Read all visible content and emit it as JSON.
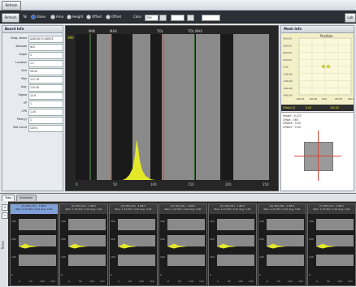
{
  "titlebar": {
    "button_label": "Refresh"
  },
  "toolbar": {
    "view_label": "Tol",
    "radios": [
      {
        "label": "Value",
        "on": true
      },
      {
        "label": "Area",
        "on": false
      },
      {
        "label": "Height",
        "on": false
      },
      {
        "label": "Offset",
        "on": false
      },
      {
        "label": "Offset",
        "on": false
      }
    ],
    "color_label": "Color",
    "color_value": "255",
    "right_btn": "Lab"
  },
  "board_info": {
    "title": "Board Info",
    "rows": [
      {
        "label": "Brdg. Name",
        "value": "AA8CB0 M ADBCE"
      },
      {
        "label": "Barcode",
        "value": "N/A"
      },
      {
        "label": "Angle",
        "value": "0"
      },
      {
        "label": "Location",
        "value": "1.2"
      },
      {
        "label": "Size",
        "value": "56.00"
      },
      {
        "label": "Max",
        "value": "121.78"
      },
      {
        "label": "Avg.",
        "value": "120.00"
      },
      {
        "label": "Sigma",
        "value": "10.6"
      },
      {
        "label": "CP",
        "value": "1"
      },
      {
        "label": "CPK",
        "value": "1.00"
      },
      {
        "label": "Pixel(y)",
        "value": "1"
      },
      {
        "label": "Pad Count",
        "value": "100%"
      }
    ]
  },
  "histogram": {
    "y_label": "300",
    "top_labels": [
      "MIN",
      "MAX",
      "TOL",
      "TOL MAX"
    ],
    "x_ticks": [
      "0",
      "50",
      "100",
      "150",
      "200",
      "250"
    ]
  },
  "mesh_info": {
    "title": "Mesh Info",
    "plot_title": "Position",
    "y_ticks": [
      "400.00",
      "300.00",
      "200.00",
      "100.00",
      "0.00",
      "-100.00",
      "-200.00",
      "-300.00",
      "-400.00"
    ],
    "x_ticks": [
      "-400.00",
      "-200.00",
      "0.00",
      "200.00",
      "400.00"
    ],
    "legend": [
      {
        "label": "Offset(-3)",
        "value": "0.00"
      },
      {
        "label": "",
        "value": "100.00"
      }
    ],
    "detail": [
      "Height : 0.123",
      "Offset : 365",
      "OffsetX : 0.00",
      "OffsetY : 0.00"
    ]
  },
  "bottom": {
    "tabs": [
      "Tabs",
      "Selection"
    ],
    "side_label": "Trend",
    "charts": [
      {
        "title": "[1] Vth(ch1) : 1.88 V",
        "sub": "Max: 1.10  Min: 0.10  Avg: 3.00",
        "selected": true
      },
      {
        "title": "[2] Vth(ch2) : 1.88 V",
        "sub": "Max: 1.10  Min: 0.10  Avg: 3.00",
        "selected": false
      },
      {
        "title": "[3] Vth(ch3) : 1.88 V",
        "sub": "Max: 1.10  Min: 0.10  Avg: 3.00",
        "selected": false
      },
      {
        "title": "[4] Vth(ch4) : 1.88 V",
        "sub": "Max: 1.10  Min: 0.10  Avg: 3.00",
        "selected": false
      },
      {
        "title": "[5] Vth(ch5) : 1.88 V",
        "sub": "Max: 1.10  Min: 0.10  Avg: 3.00",
        "selected": false
      },
      {
        "title": "[6] Vth(ch6) : 1.88 V",
        "sub": "Max: 1.10  Min: 0.10  Avg: 3.00",
        "selected": false
      },
      {
        "title": "[7] Vth(ch7) : 1.88 V",
        "sub": "Max: 1.10  Min: 0.10  Avg: 3.00",
        "selected": false
      }
    ],
    "mini_y_ticks": [
      "300",
      "200",
      "100",
      "0"
    ],
    "mini_x_ticks": [
      "0",
      "50",
      "100",
      "150"
    ]
  },
  "colors": {
    "accent_yellow": "#e3e82a",
    "limit_red": "#d24a3a",
    "limit_green": "#5aa05a",
    "selected_blue": "#7fa1d8"
  }
}
